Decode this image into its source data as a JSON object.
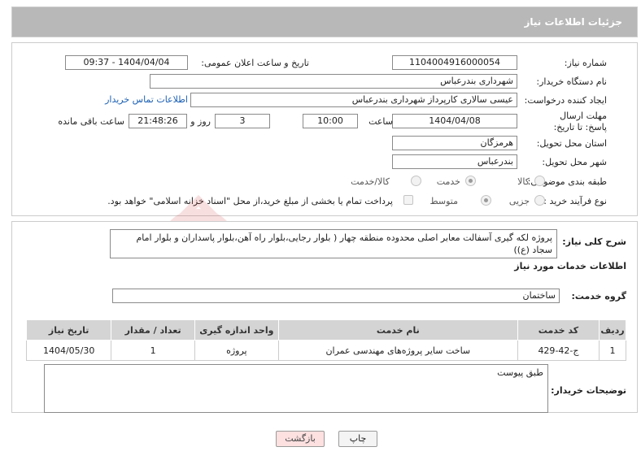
{
  "header": {
    "title": "جزئیات اطلاعات نیاز"
  },
  "need": {
    "number_label": "شماره نیاز:",
    "number": "1104004916000054",
    "announce_label": "تاریخ و ساعت اعلان عمومی:",
    "announce": "1404/04/04 - 09:37",
    "buyer_label": "نام دستگاه خریدار:",
    "buyer": "شهرداری بندرعباس",
    "creator_label": "ایجاد کننده درخواست:",
    "creator": "عیسی سالاری کارپرداز شهرداری بندرعباس",
    "contact_link": "اطلاعات تماس خریدار",
    "deadline_label": "مهلت ارسال پاسخ: تا تاریخ:",
    "deadline_date": "1404/04/08",
    "time_label": "ساعت",
    "deadline_time": "10:00",
    "days": "3",
    "days_label": "روز و",
    "remaining": "21:48:26",
    "remaining_label": "ساعت باقی مانده",
    "province_label": "استان محل تحویل:",
    "province": "هرمزگان",
    "city_label": "شهر محل تحویل:",
    "city": "بندرعباس",
    "category_label": "طبقه بندی موضوعی:",
    "category_options": [
      "کالا",
      "خدمت",
      "کالا/خدمت"
    ],
    "category_selected": "خدمت",
    "process_label": "نوع فرآیند خرید :",
    "process_options": [
      "جزیی",
      "متوسط"
    ],
    "process_selected": "متوسط",
    "payment_note": "پرداخت تمام یا بخشی از مبلغ خرید،از محل \"اسناد خزانه اسلامی\" خواهد بود."
  },
  "description": {
    "label": "شرح کلی نیاز:",
    "text": "پروژه لکه گیری آسفالت معابر اصلی محدوده منطقه چهار ( بلوار رجایی،بلوار راه آهن،بلوار پاسداران و بلوار امام سجاد (ع))"
  },
  "services": {
    "section_title": "اطلاعات خدمات مورد نیاز",
    "group_label": "گروه خدمت:",
    "group": "ساختمان",
    "columns": [
      "ردیف",
      "کد خدمت",
      "نام خدمت",
      "واحد اندازه گیری",
      "تعداد / مقدار",
      "تاریخ نیاز"
    ],
    "rows": [
      {
        "row": "1",
        "code": "ج-42-429",
        "name": "ساخت سایر پروژه‌های مهندسی عمران",
        "unit": "پروژه",
        "qty": "1",
        "date": "1404/05/30"
      }
    ]
  },
  "notes": {
    "label": "توضیحات خریدار:",
    "text": "طبق پیوست"
  },
  "buttons": {
    "print": "چاپ",
    "back": "بازگشت"
  },
  "watermark": {
    "text": "AriaTender.neT",
    "color": "#d23c3c"
  }
}
